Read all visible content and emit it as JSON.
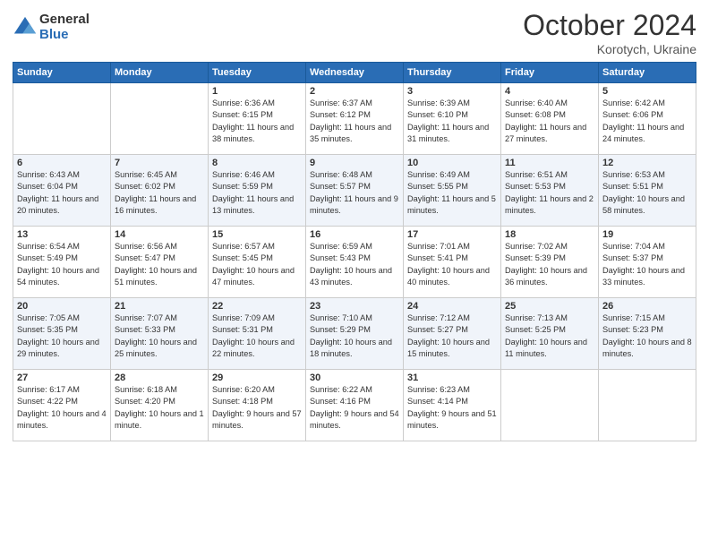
{
  "header": {
    "logo_general": "General",
    "logo_blue": "Blue",
    "month_title": "October 2024",
    "location": "Korotych, Ukraine"
  },
  "days_of_week": [
    "Sunday",
    "Monday",
    "Tuesday",
    "Wednesday",
    "Thursday",
    "Friday",
    "Saturday"
  ],
  "weeks": [
    [
      {
        "day": "",
        "sunrise": "",
        "sunset": "",
        "daylight": ""
      },
      {
        "day": "",
        "sunrise": "",
        "sunset": "",
        "daylight": ""
      },
      {
        "day": "1",
        "sunrise": "Sunrise: 6:36 AM",
        "sunset": "Sunset: 6:15 PM",
        "daylight": "Daylight: 11 hours and 38 minutes."
      },
      {
        "day": "2",
        "sunrise": "Sunrise: 6:37 AM",
        "sunset": "Sunset: 6:12 PM",
        "daylight": "Daylight: 11 hours and 35 minutes."
      },
      {
        "day": "3",
        "sunrise": "Sunrise: 6:39 AM",
        "sunset": "Sunset: 6:10 PM",
        "daylight": "Daylight: 11 hours and 31 minutes."
      },
      {
        "day": "4",
        "sunrise": "Sunrise: 6:40 AM",
        "sunset": "Sunset: 6:08 PM",
        "daylight": "Daylight: 11 hours and 27 minutes."
      },
      {
        "day": "5",
        "sunrise": "Sunrise: 6:42 AM",
        "sunset": "Sunset: 6:06 PM",
        "daylight": "Daylight: 11 hours and 24 minutes."
      }
    ],
    [
      {
        "day": "6",
        "sunrise": "Sunrise: 6:43 AM",
        "sunset": "Sunset: 6:04 PM",
        "daylight": "Daylight: 11 hours and 20 minutes."
      },
      {
        "day": "7",
        "sunrise": "Sunrise: 6:45 AM",
        "sunset": "Sunset: 6:02 PM",
        "daylight": "Daylight: 11 hours and 16 minutes."
      },
      {
        "day": "8",
        "sunrise": "Sunrise: 6:46 AM",
        "sunset": "Sunset: 5:59 PM",
        "daylight": "Daylight: 11 hours and 13 minutes."
      },
      {
        "day": "9",
        "sunrise": "Sunrise: 6:48 AM",
        "sunset": "Sunset: 5:57 PM",
        "daylight": "Daylight: 11 hours and 9 minutes."
      },
      {
        "day": "10",
        "sunrise": "Sunrise: 6:49 AM",
        "sunset": "Sunset: 5:55 PM",
        "daylight": "Daylight: 11 hours and 5 minutes."
      },
      {
        "day": "11",
        "sunrise": "Sunrise: 6:51 AM",
        "sunset": "Sunset: 5:53 PM",
        "daylight": "Daylight: 11 hours and 2 minutes."
      },
      {
        "day": "12",
        "sunrise": "Sunrise: 6:53 AM",
        "sunset": "Sunset: 5:51 PM",
        "daylight": "Daylight: 10 hours and 58 minutes."
      }
    ],
    [
      {
        "day": "13",
        "sunrise": "Sunrise: 6:54 AM",
        "sunset": "Sunset: 5:49 PM",
        "daylight": "Daylight: 10 hours and 54 minutes."
      },
      {
        "day": "14",
        "sunrise": "Sunrise: 6:56 AM",
        "sunset": "Sunset: 5:47 PM",
        "daylight": "Daylight: 10 hours and 51 minutes."
      },
      {
        "day": "15",
        "sunrise": "Sunrise: 6:57 AM",
        "sunset": "Sunset: 5:45 PM",
        "daylight": "Daylight: 10 hours and 47 minutes."
      },
      {
        "day": "16",
        "sunrise": "Sunrise: 6:59 AM",
        "sunset": "Sunset: 5:43 PM",
        "daylight": "Daylight: 10 hours and 43 minutes."
      },
      {
        "day": "17",
        "sunrise": "Sunrise: 7:01 AM",
        "sunset": "Sunset: 5:41 PM",
        "daylight": "Daylight: 10 hours and 40 minutes."
      },
      {
        "day": "18",
        "sunrise": "Sunrise: 7:02 AM",
        "sunset": "Sunset: 5:39 PM",
        "daylight": "Daylight: 10 hours and 36 minutes."
      },
      {
        "day": "19",
        "sunrise": "Sunrise: 7:04 AM",
        "sunset": "Sunset: 5:37 PM",
        "daylight": "Daylight: 10 hours and 33 minutes."
      }
    ],
    [
      {
        "day": "20",
        "sunrise": "Sunrise: 7:05 AM",
        "sunset": "Sunset: 5:35 PM",
        "daylight": "Daylight: 10 hours and 29 minutes."
      },
      {
        "day": "21",
        "sunrise": "Sunrise: 7:07 AM",
        "sunset": "Sunset: 5:33 PM",
        "daylight": "Daylight: 10 hours and 25 minutes."
      },
      {
        "day": "22",
        "sunrise": "Sunrise: 7:09 AM",
        "sunset": "Sunset: 5:31 PM",
        "daylight": "Daylight: 10 hours and 22 minutes."
      },
      {
        "day": "23",
        "sunrise": "Sunrise: 7:10 AM",
        "sunset": "Sunset: 5:29 PM",
        "daylight": "Daylight: 10 hours and 18 minutes."
      },
      {
        "day": "24",
        "sunrise": "Sunrise: 7:12 AM",
        "sunset": "Sunset: 5:27 PM",
        "daylight": "Daylight: 10 hours and 15 minutes."
      },
      {
        "day": "25",
        "sunrise": "Sunrise: 7:13 AM",
        "sunset": "Sunset: 5:25 PM",
        "daylight": "Daylight: 10 hours and 11 minutes."
      },
      {
        "day": "26",
        "sunrise": "Sunrise: 7:15 AM",
        "sunset": "Sunset: 5:23 PM",
        "daylight": "Daylight: 10 hours and 8 minutes."
      }
    ],
    [
      {
        "day": "27",
        "sunrise": "Sunrise: 6:17 AM",
        "sunset": "Sunset: 4:22 PM",
        "daylight": "Daylight: 10 hours and 4 minutes."
      },
      {
        "day": "28",
        "sunrise": "Sunrise: 6:18 AM",
        "sunset": "Sunset: 4:20 PM",
        "daylight": "Daylight: 10 hours and 1 minute."
      },
      {
        "day": "29",
        "sunrise": "Sunrise: 6:20 AM",
        "sunset": "Sunset: 4:18 PM",
        "daylight": "Daylight: 9 hours and 57 minutes."
      },
      {
        "day": "30",
        "sunrise": "Sunrise: 6:22 AM",
        "sunset": "Sunset: 4:16 PM",
        "daylight": "Daylight: 9 hours and 54 minutes."
      },
      {
        "day": "31",
        "sunrise": "Sunrise: 6:23 AM",
        "sunset": "Sunset: 4:14 PM",
        "daylight": "Daylight: 9 hours and 51 minutes."
      },
      {
        "day": "",
        "sunrise": "",
        "sunset": "",
        "daylight": ""
      },
      {
        "day": "",
        "sunrise": "",
        "sunset": "",
        "daylight": ""
      }
    ]
  ]
}
